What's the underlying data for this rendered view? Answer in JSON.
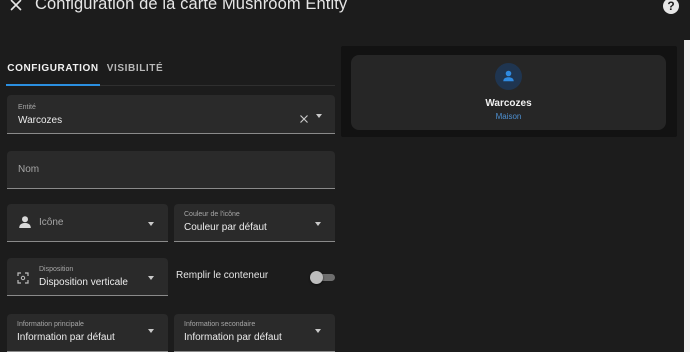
{
  "header": {
    "title": "Configuration de la carte Mushroom Entity",
    "close_icon": "close-icon",
    "help_icon": "help-circle-icon",
    "help_glyph": "?"
  },
  "tabs": [
    {
      "label": "CONFIGURATION",
      "active": true
    },
    {
      "label": "VISIBILITÉ",
      "active": false
    }
  ],
  "form": {
    "entity": {
      "label": "Entité",
      "value": "Warcozes"
    },
    "name": {
      "placeholder": "Nom"
    },
    "icon": {
      "placeholder": "Icône",
      "icon": "account-icon"
    },
    "icon_color": {
      "label": "Couleur de l'icône",
      "value": "Couleur par défaut"
    },
    "layout": {
      "label": "Disposition",
      "value": "Disposition verticale",
      "icon": "focus-frame-icon"
    },
    "fill_container": {
      "label": "Remplir le conteneur",
      "checked": false
    },
    "primary_info": {
      "label": "Information principale",
      "value": "Information par défaut"
    },
    "secondary_info": {
      "label": "Information secondaire",
      "value": "Information par défaut"
    }
  },
  "preview": {
    "name": "Warcozes",
    "secondary": "Maison",
    "icon": "account-icon"
  },
  "colors": {
    "accent": "#2b8fe0",
    "background": "#1c1c1c",
    "field": "#2a2a2a",
    "preview_bg": "#121212",
    "card_bg": "#262626",
    "secondary_text": "#4d8fd0"
  }
}
